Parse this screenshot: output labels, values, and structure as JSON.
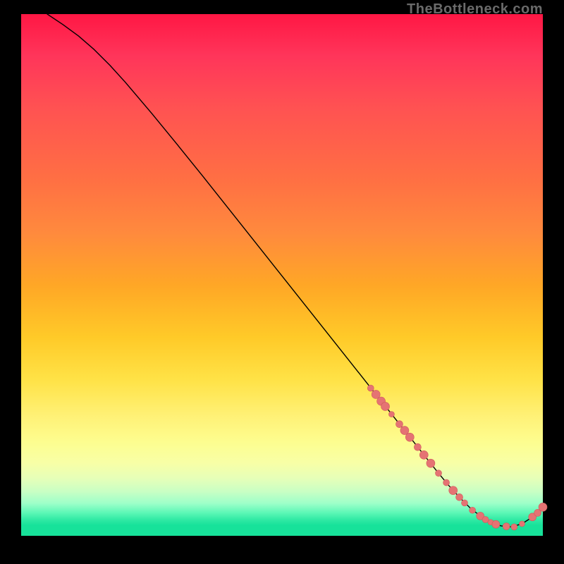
{
  "watermark": "TheBottleneck.com",
  "chart_data": {
    "type": "line",
    "title": "",
    "xlabel": "",
    "ylabel": "",
    "xlim": [
      0,
      100
    ],
    "ylim": [
      0,
      100
    ],
    "grid": false,
    "legend_position": "none",
    "curve": {
      "x": [
        5,
        8,
        11,
        14,
        17,
        20,
        25,
        30,
        35,
        40,
        45,
        50,
        55,
        60,
        65,
        68,
        70,
        73,
        75,
        78,
        80,
        82,
        84,
        86,
        88,
        90,
        92,
        94,
        96,
        98,
        100
      ],
      "y": [
        100,
        98,
        95.8,
        93.2,
        90.2,
        86.9,
        81.0,
        74.9,
        68.7,
        62.4,
        56.1,
        49.8,
        43.5,
        37.2,
        30.9,
        27.1,
        24.6,
        20.8,
        18.3,
        14.5,
        12.0,
        9.6,
        7.4,
        5.4,
        3.8,
        2.6,
        1.9,
        1.7,
        2.3,
        3.6,
        5.5
      ]
    },
    "points": {
      "x": [
        67,
        68,
        69,
        69.8,
        71,
        72.5,
        73.5,
        74.5,
        76,
        77.2,
        78.5,
        80,
        81.5,
        82.8,
        84,
        85,
        86.5,
        88,
        89,
        90,
        91,
        93,
        94.5,
        96,
        98,
        99,
        100
      ],
      "y": [
        28.3,
        27.1,
        25.8,
        24.8,
        23.3,
        21.4,
        20.2,
        18.9,
        17.0,
        15.5,
        13.9,
        12.0,
        10.2,
        8.7,
        7.4,
        6.3,
        4.9,
        3.8,
        3.1,
        2.6,
        2.2,
        1.8,
        1.7,
        2.3,
        3.6,
        4.4,
        5.5
      ],
      "r": [
        4.5,
        6,
        6,
        6,
        4,
        5,
        6,
        6,
        5,
        6,
        6,
        4.5,
        4.5,
        6,
        5,
        4.5,
        4.5,
        5.5,
        4.5,
        4,
        5.5,
        5,
        4.5,
        4,
        5.5,
        5,
        6
      ]
    }
  }
}
